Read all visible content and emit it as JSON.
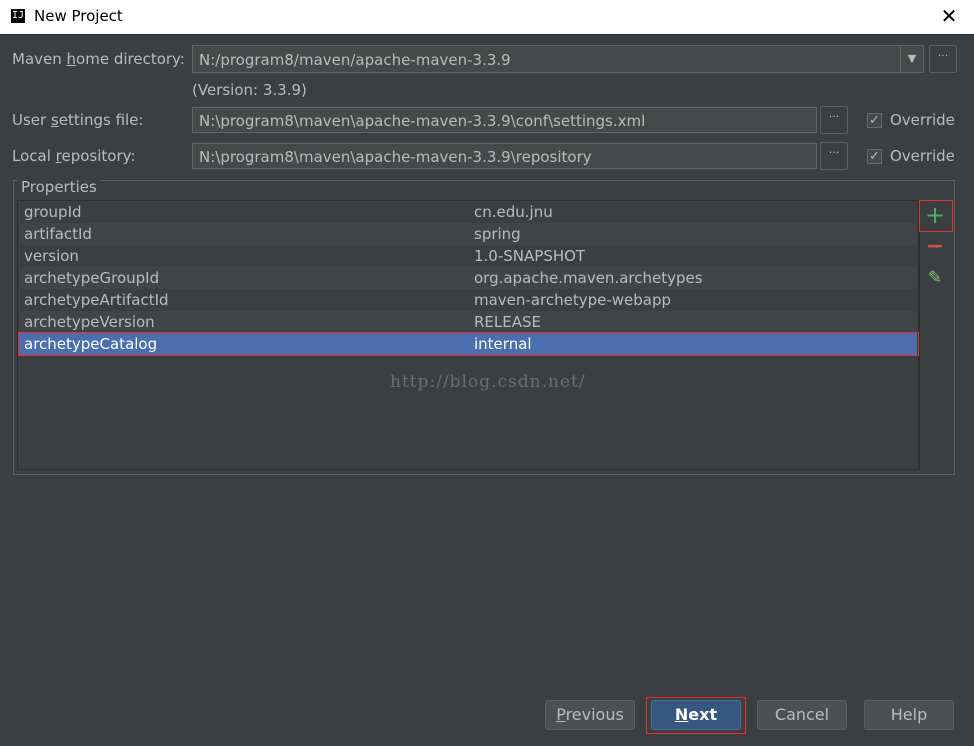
{
  "window": {
    "title": "New Project",
    "icon": "intellij-icon",
    "close": "✕"
  },
  "maven_home": {
    "label_pre": "Maven ",
    "label_u": "h",
    "label_post": "ome directory:",
    "value": "N:/program8/maven/apache-maven-3.3.9",
    "version_note": "(Version: 3.3.9)"
  },
  "user_settings": {
    "label_pre": "User ",
    "label_u": "s",
    "label_post": "ettings file:",
    "value": "N:\\program8\\maven\\apache-maven-3.3.9\\conf\\settings.xml",
    "override_label": "Override",
    "override_checked": true
  },
  "local_repo": {
    "label_pre": "Local ",
    "label_u": "r",
    "label_post": "epository:",
    "value": "N:\\program8\\maven\\apache-maven-3.3.9\\repository",
    "override_label": "Override",
    "override_checked": true
  },
  "ellipsis": "···",
  "checkmark": "✓",
  "dropdown_arrow": "▼",
  "properties": {
    "title": "Properties",
    "rows": [
      {
        "key": "groupId",
        "value": "cn.edu.jnu"
      },
      {
        "key": "artifactId",
        "value": "spring"
      },
      {
        "key": "version",
        "value": "1.0-SNAPSHOT"
      },
      {
        "key": "archetypeGroupId",
        "value": "org.apache.maven.archetypes"
      },
      {
        "key": "archetypeArtifactId",
        "value": "maven-archetype-webapp"
      },
      {
        "key": "archetypeVersion",
        "value": "RELEASE"
      },
      {
        "key": "archetypeCatalog",
        "value": "internal"
      }
    ],
    "selected_index": 6,
    "tools": {
      "add": "+",
      "remove": "−",
      "edit": "✎"
    }
  },
  "watermark": "http://blog.csdn.net/",
  "buttons": {
    "previous": {
      "u": "P",
      "rest": "revious"
    },
    "next": {
      "u": "N",
      "rest": "ext"
    },
    "cancel": "Cancel",
    "help": "Help"
  },
  "colors": {
    "background": "#3c3f41",
    "selection": "#4b6eaf",
    "highlight_box": "#e53030",
    "add_green": "#59a869",
    "remove_red": "#c75450"
  }
}
